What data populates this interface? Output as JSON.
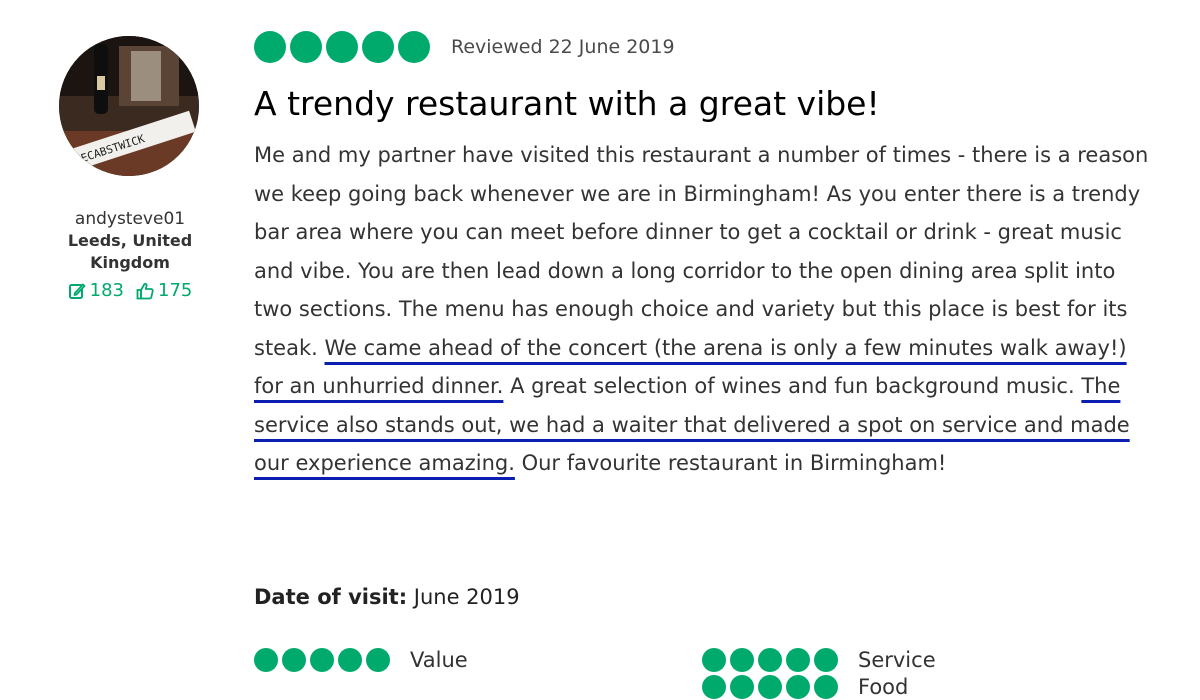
{
  "reviewer": {
    "username": "andysteve01",
    "location": "Leeds, United Kingdom",
    "contributions": "183",
    "helpful_votes": "175",
    "avatar_text": "#ECABSTWICK"
  },
  "review": {
    "rating": 5,
    "reviewed_date": "Reviewed 22 June 2019",
    "title": "A trendy restaurant with a great vibe!",
    "body": {
      "part1": "Me and my partner have visited this restaurant a number of times - there is a reason we keep going back whenever we are in Birmingham! As you enter there is a trendy bar area where you can meet before dinner to get a cocktail or drink - great music and vibe. You are then lead down a long corridor to the open dining area split into two sections. The menu has enough choice and variety but this place is best for its steak. ",
      "highlight1": "We came ahead of the concert (the arena is only a few minutes walk away!) for an unhurried dinner.",
      "part2": " A great selection of wines and fun background music. ",
      "highlight2": "The service also stands out, we had a waiter that delivered a spot on service and made our experience amazing.",
      "part3": " Our favourite restaurant in Birmingham!"
    },
    "date_of_visit_label": "Date of visit:",
    "date_of_visit_value": " June 2019",
    "sub_ratings": [
      {
        "label": "Value",
        "rating": 5
      },
      {
        "label": "Service",
        "rating": 5
      },
      {
        "label": "Food",
        "rating": 5
      }
    ]
  },
  "colors": {
    "bubble": "#00aa6c",
    "highlight_underline": "#0a1fb0"
  },
  "icons": {
    "contributions": "edit-icon",
    "helpful": "thumbs-up-icon"
  }
}
